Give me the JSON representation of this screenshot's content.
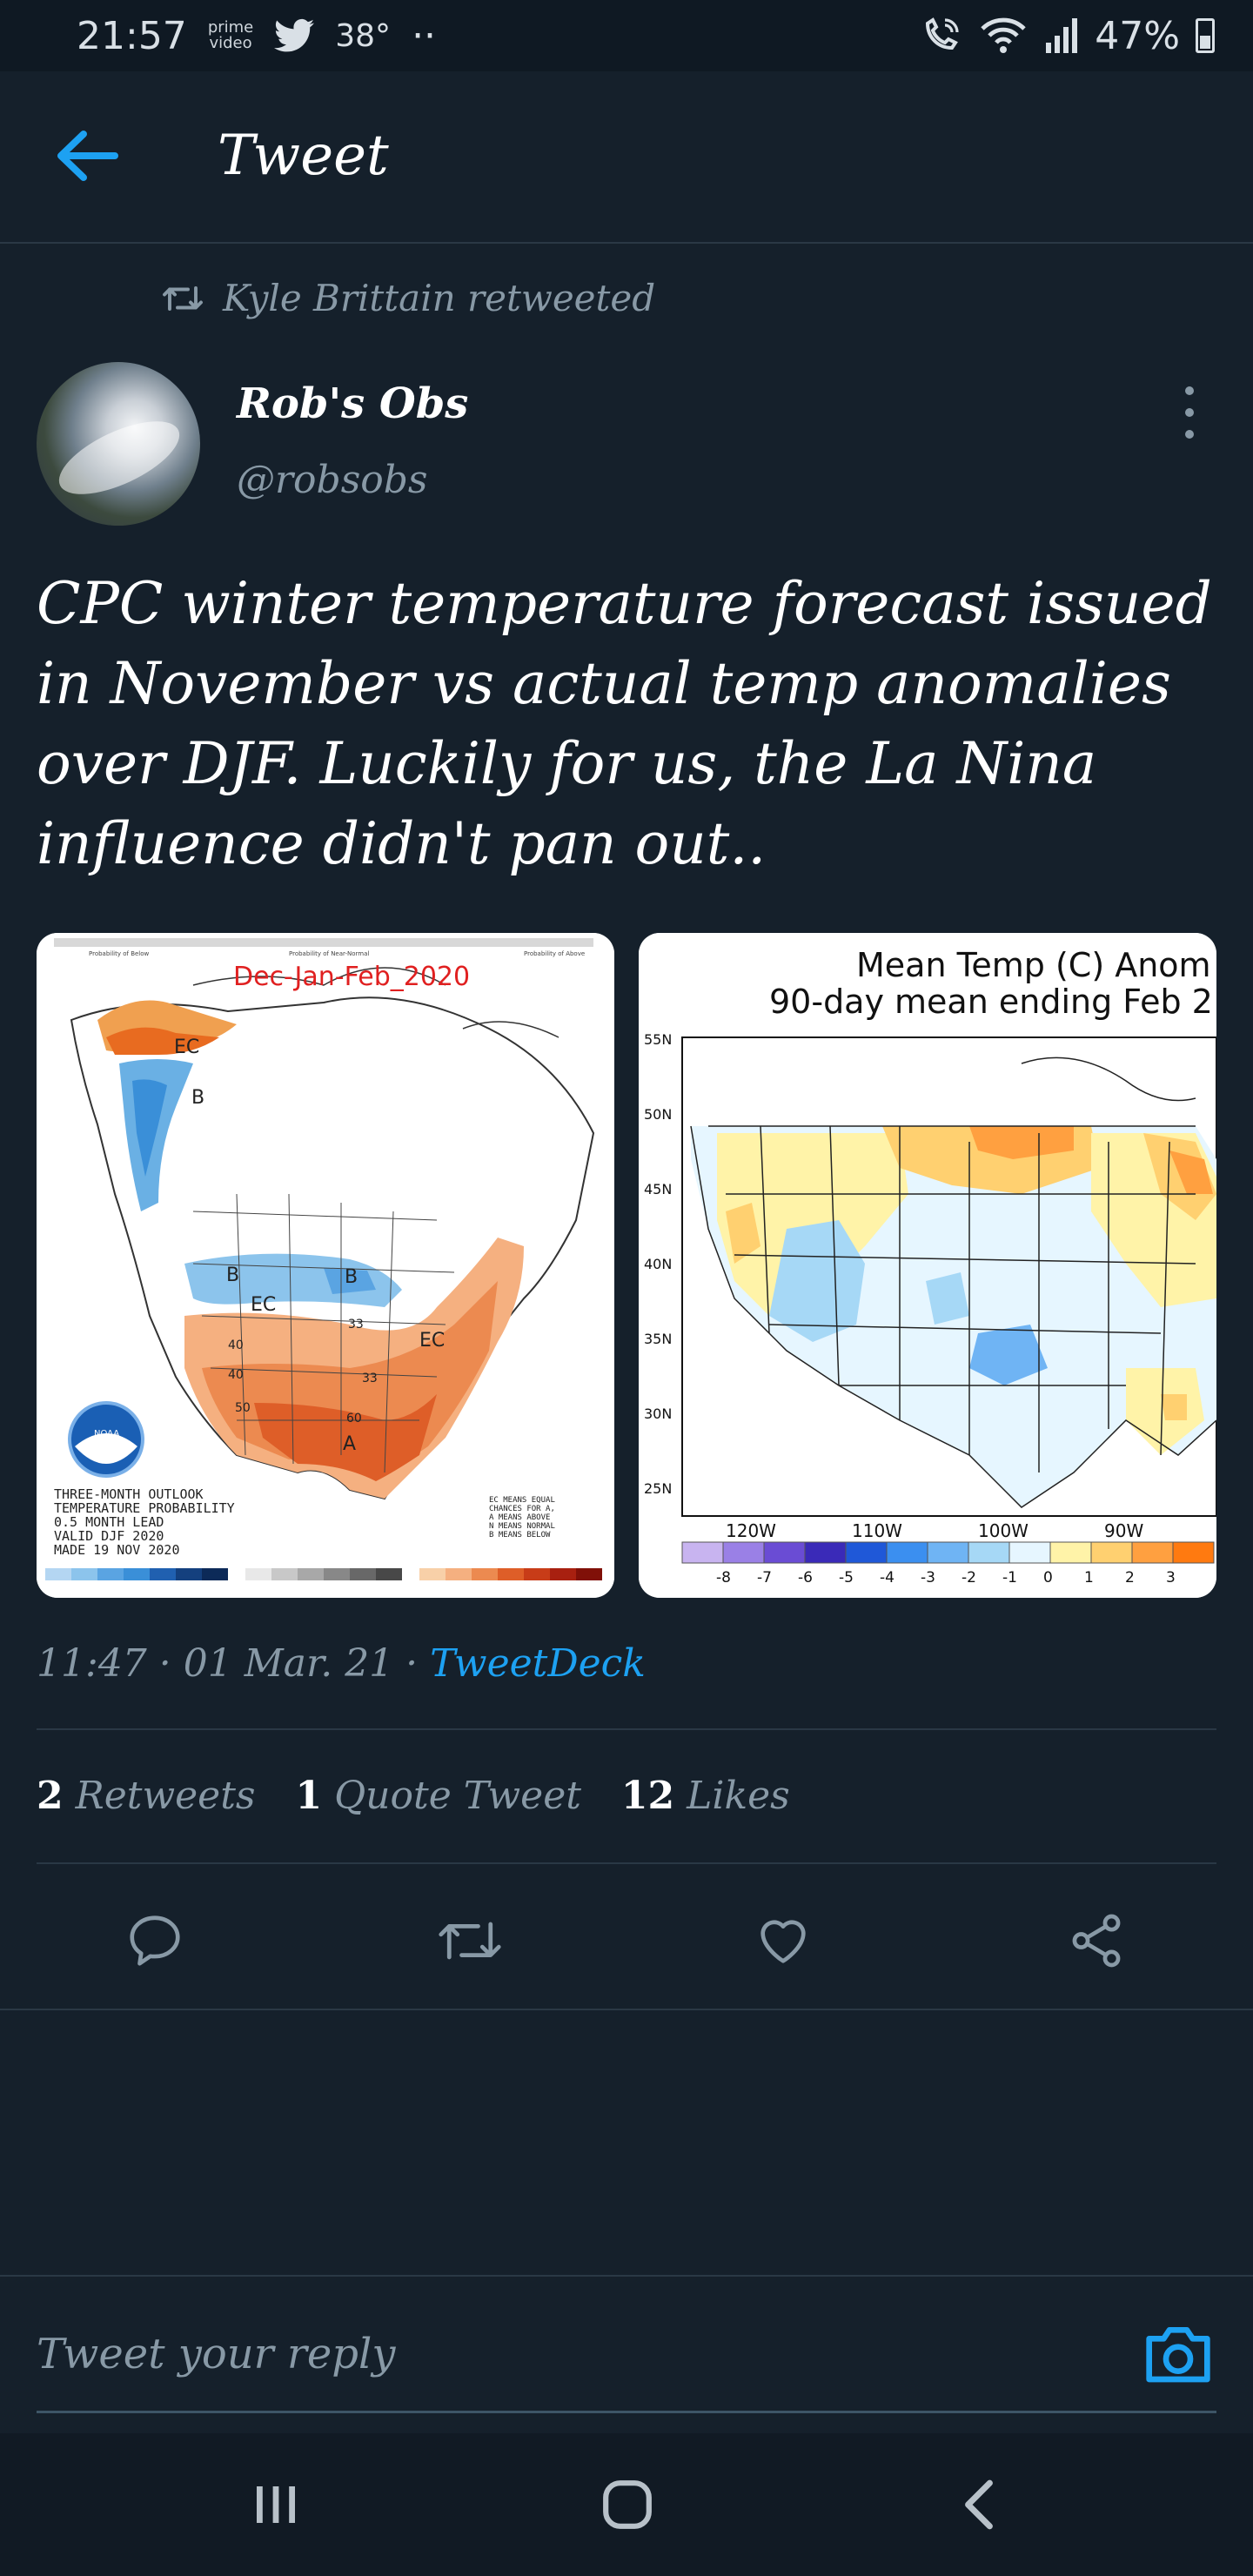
{
  "status_bar": {
    "time": "21:57",
    "prime_line1": "prime",
    "prime_line2": "video",
    "temperature": "38°",
    "dots": "··",
    "battery": "47%"
  },
  "header": {
    "title": "Tweet"
  },
  "retweet_note": "Kyle Brittain retweeted",
  "author": {
    "name": "Rob's Obs",
    "handle": "@robsobs"
  },
  "tweet_text": "CPC winter temperature forecast issued in November vs actual temp anomalies over DJF. Luckily for us, the La Nina influence didn't pan out..",
  "media": {
    "left": {
      "title": "Dec-Jan-Feb_2020",
      "notes": [
        "THREE-MONTH OUTLOOK",
        "TEMPERATURE PROBABILITY",
        "0.5 MONTH LEAD",
        "VALID DJF 2020",
        "MADE 19 NOV 2020"
      ],
      "legend_notes": [
        "EC MEANS EQUAL",
        "CHANCES FOR A,",
        "A MEANS ABOVE",
        "N MEANS NORMAL",
        "B MEANS BELOW"
      ],
      "region_labels": [
        "EC",
        "B",
        "B",
        "B",
        "EC",
        "EC",
        "40",
        "40",
        "50",
        "60",
        "A",
        "33",
        "33"
      ],
      "logo_text": "NOAA",
      "top_captions": [
        "Probability of Below",
        "Probability of Near-Normal",
        "Probability of Above"
      ]
    },
    "right": {
      "title_line1": "Mean Temp (C) Anom",
      "title_line2": "90-day mean ending Feb 2",
      "lat_labels": [
        "55N",
        "50N",
        "45N",
        "40N",
        "35N",
        "30N",
        "25N"
      ],
      "lon_labels": [
        "120W",
        "110W",
        "100W",
        "90W"
      ],
      "scale_labels": [
        "-8",
        "-7",
        "-6",
        "-5",
        "-4",
        "-3",
        "-2",
        "-1",
        "0",
        "1",
        "2",
        "3"
      ],
      "scale_colors": [
        "#c8b4f0",
        "#9a80e6",
        "#6a4cd4",
        "#3a2ab8",
        "#1f58d8",
        "#3b8ff0",
        "#6fb4f4",
        "#a6d8f6",
        "#e6f6ff",
        "#fff3a8",
        "#ffd070",
        "#ffa040",
        "#ff7a10"
      ]
    }
  },
  "timestamp": {
    "time": "11:47 · 01 Mar. 21 · ",
    "source": "TweetDeck"
  },
  "stats": {
    "retweets_count": "2",
    "retweets_label": "Retweets",
    "quotes_count": "1",
    "quotes_label": "Quote Tweet",
    "likes_count": "12",
    "likes_label": "Likes"
  },
  "reply": {
    "placeholder": "Tweet your reply"
  },
  "colors": {
    "background": "#15202b",
    "accent": "#1da1f2",
    "muted": "#8899a6"
  }
}
